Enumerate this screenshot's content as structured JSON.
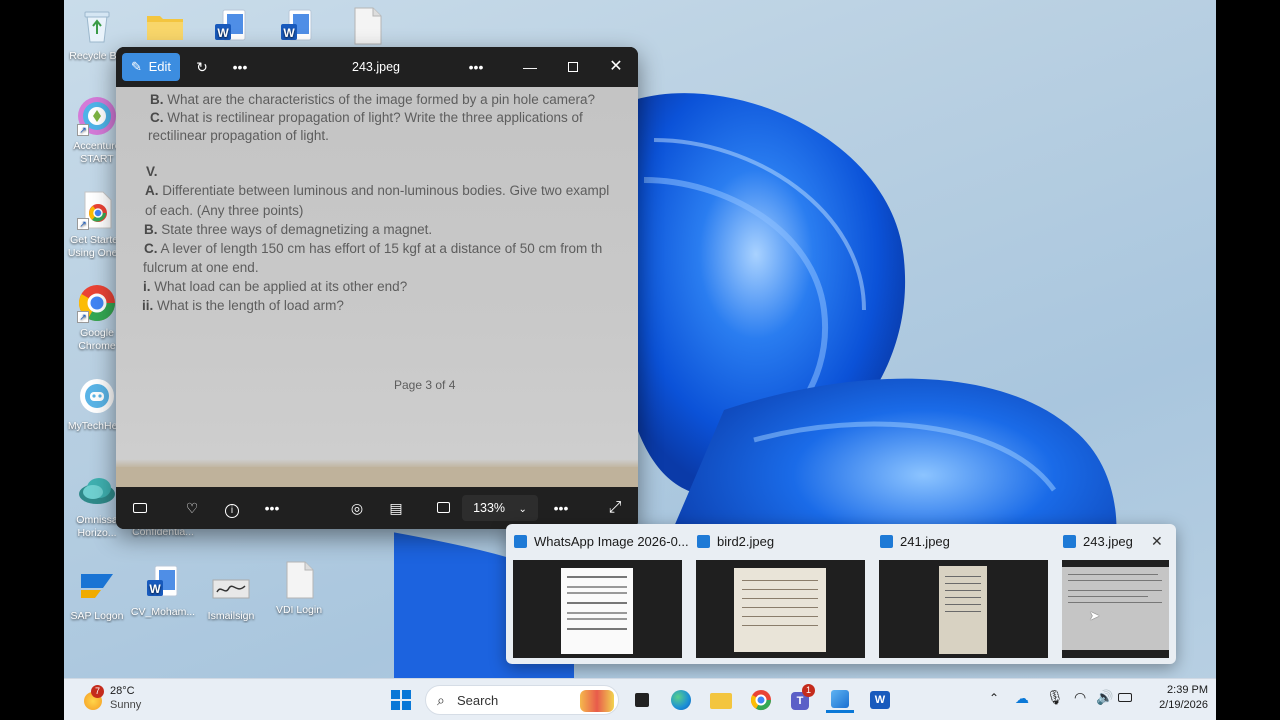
{
  "desktop": {
    "icons": [
      {
        "name": "recycle-bin",
        "label": "Recycle Bin"
      },
      {
        "name": "folder",
        "label": ""
      },
      {
        "name": "word-doc-1",
        "label": ""
      },
      {
        "name": "word-doc-2",
        "label": ""
      },
      {
        "name": "text-file",
        "label": ""
      },
      {
        "name": "accenture-start",
        "label": "Accenture START"
      },
      {
        "name": "get-started-onedrive",
        "label": "Get Started Using One..."
      },
      {
        "name": "google-chrome",
        "label": "Google Chrome"
      },
      {
        "name": "mytechhelp",
        "label": "MyTechHe..."
      },
      {
        "name": "omnissa-horizon",
        "label": "Omnissa Horizo..."
      },
      {
        "name": "confidential",
        "label": "Confidentia..."
      },
      {
        "name": "sap-logon",
        "label": "SAP Logon"
      },
      {
        "name": "cv-mohammed",
        "label": "CV_Moham..."
      },
      {
        "name": "ismailsign",
        "label": "Ismailsign"
      },
      {
        "name": "vdi-login",
        "label": "VDI Login"
      }
    ]
  },
  "viewer": {
    "title": "243.jpeg",
    "edit_label": "Edit",
    "zoom": "133%",
    "document": {
      "lines": [
        {
          "tag": "B.",
          "text": "What are the characteristics of the image formed by a pin hole camera?"
        },
        {
          "tag": "C.",
          "text": "What is rectilinear propagation of light? Write the three applications of"
        },
        {
          "tag": "",
          "text": "rectilinear propagation of light."
        },
        {
          "tag": "V.",
          "text": ""
        },
        {
          "tag": "A.",
          "text": "Differentiate between luminous and non-luminous bodies. Give two exampl"
        },
        {
          "tag": "",
          "text": "of each. (Any three points)"
        },
        {
          "tag": "B.",
          "text": "State three ways of demagnetizing a magnet."
        },
        {
          "tag": "C.",
          "text": "A lever of length 150 cm has effort of 15 kgf at a distance of 50 cm from th"
        },
        {
          "tag": "",
          "text": "fulcrum at one end."
        },
        {
          "tag": "i.",
          "text": "What load can be applied at its other end?"
        },
        {
          "tag": "ii.",
          "text": "What is the length of load arm?"
        }
      ],
      "page_label": "Page 3 of 4"
    }
  },
  "taskbar_preview": {
    "items": [
      {
        "title": "WhatsApp Image 2026-0..."
      },
      {
        "title": "bird2.jpeg"
      },
      {
        "title": "241.jpeg"
      },
      {
        "title": "243.jpeg"
      }
    ]
  },
  "taskbar": {
    "weather_temp": "28°C",
    "weather_desc": "Sunny",
    "weather_badge": "7",
    "search_placeholder": "Search",
    "teams_badge": "1",
    "time": "2:39 PM",
    "date": "2/19/2026"
  }
}
